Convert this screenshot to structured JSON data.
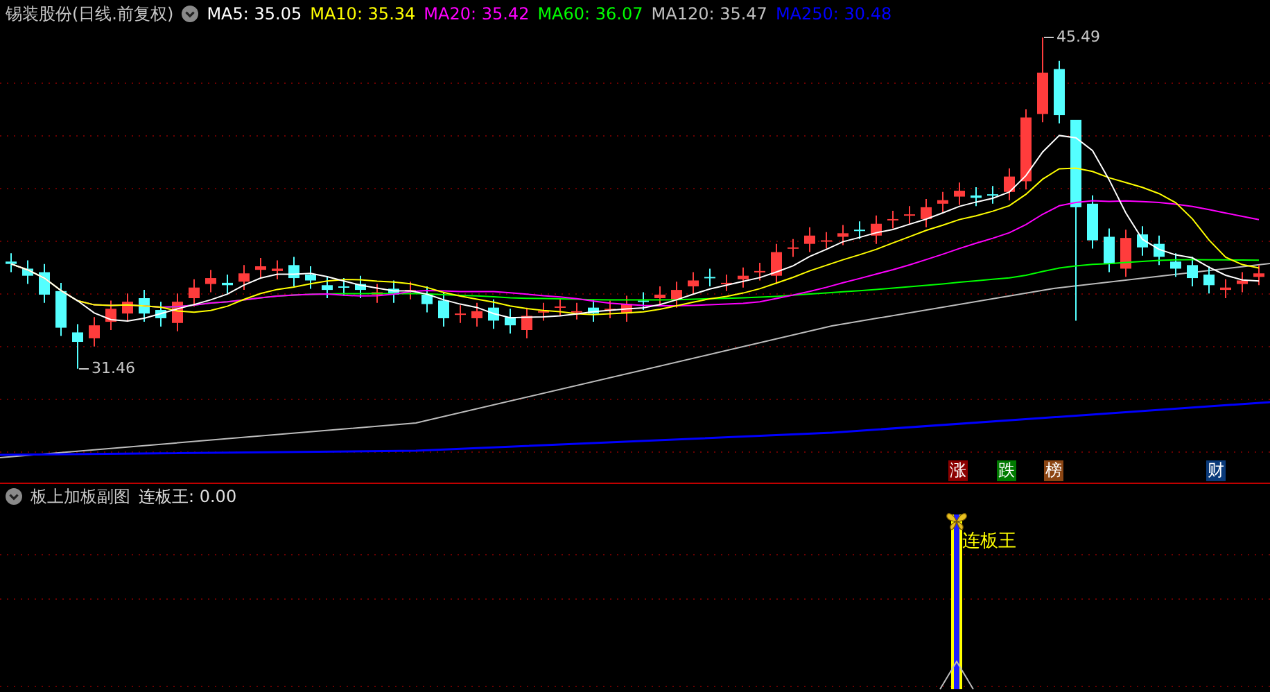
{
  "main_panel": {
    "title": "锡装股份(日线.前复权)",
    "ma_labels": [
      {
        "text": "MA5: 35.05",
        "color": "#ffffff"
      },
      {
        "text": "MA10: 35.34",
        "color": "#ffff00"
      },
      {
        "text": "MA20: 35.42",
        "color": "#ff00ff"
      },
      {
        "text": "MA60: 36.07",
        "color": "#00ff00"
      },
      {
        "text": "MA120: 35.47",
        "color": "#c0c0c0"
      },
      {
        "text": "MA250: 30.48",
        "color": "#0000ff"
      }
    ],
    "high_label": "45.49",
    "low_label": "31.46",
    "event_tags": [
      {
        "text": "涨",
        "color": "#8b0000"
      },
      {
        "text": "跌",
        "color": "#007a00"
      },
      {
        "text": "榜",
        "color": "#8b4513"
      },
      {
        "text": "财",
        "color": "#0a3a7a"
      }
    ]
  },
  "sub_panel": {
    "title": "板上加板副图",
    "indicator": "连板王: 0.00",
    "signal_label": "连板王"
  }
}
